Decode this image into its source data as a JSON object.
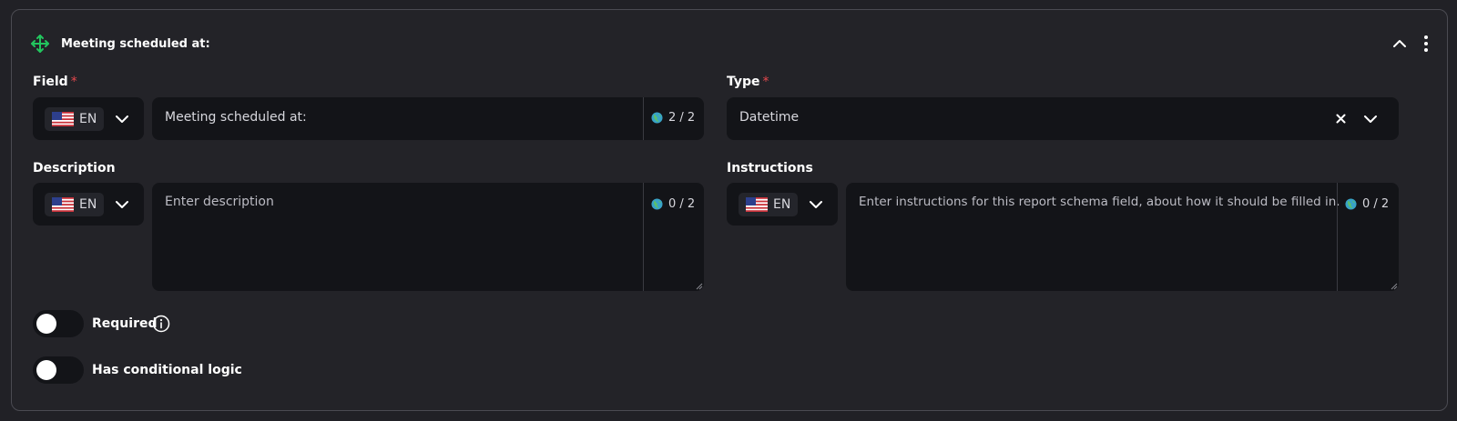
{
  "card": {
    "title": "Meeting scheduled at:",
    "icons": {
      "move": "move-icon",
      "collapse": "chevron-up-icon",
      "menu": "more-vertical-icon"
    }
  },
  "field": {
    "label": "Field",
    "required_mark": "*",
    "language": "EN",
    "value": "Meeting scheduled at:",
    "counter": "2 / 2"
  },
  "type": {
    "label": "Type",
    "required_mark": "*",
    "value": "Datetime",
    "icons": {
      "clear": "close-icon",
      "open": "chevron-down-icon"
    }
  },
  "description": {
    "label": "Description",
    "language": "EN",
    "placeholder": "Enter description",
    "counter": "0 / 2"
  },
  "instructions": {
    "label": "Instructions",
    "language": "EN",
    "placeholder": "Enter instructions for this report schema field, about how it should be filled in.",
    "counter": "0 / 2"
  },
  "toggles": {
    "required": {
      "label": "Required",
      "on": false
    },
    "conditional": {
      "label": "Has conditional logic",
      "on": false
    }
  },
  "colors": {
    "background": "#212126",
    "input_background": "#131418",
    "required_mark": "#e5484d",
    "move_icon": "#22c55e"
  }
}
